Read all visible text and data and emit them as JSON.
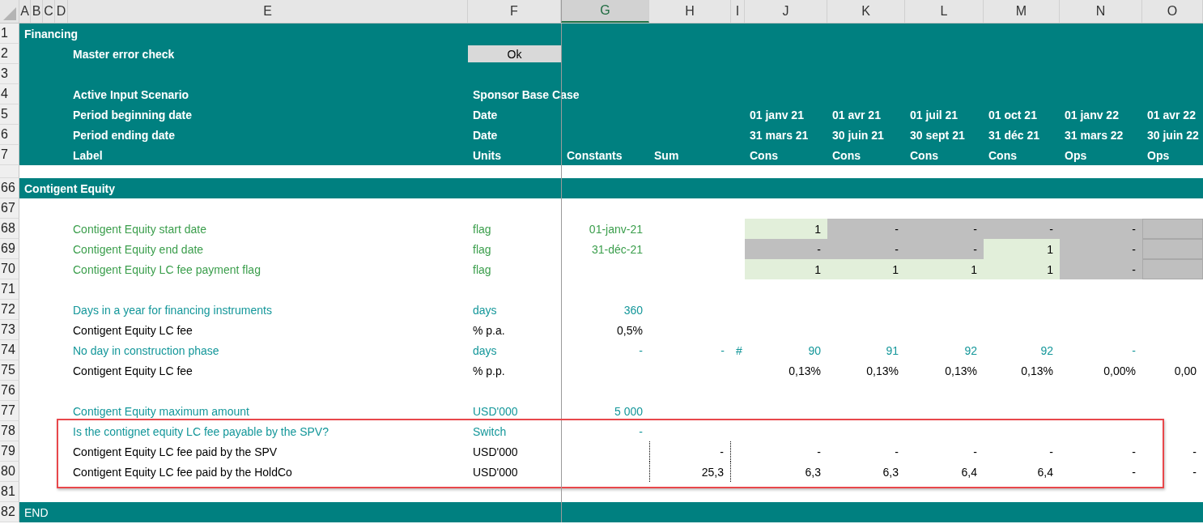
{
  "columns": [
    {
      "label": "A",
      "selected": false
    },
    {
      "label": "B",
      "selected": false
    },
    {
      "label": "C",
      "selected": false
    },
    {
      "label": "D",
      "selected": false
    },
    {
      "label": "E",
      "selected": false
    },
    {
      "label": "F",
      "selected": false
    },
    {
      "label": "G",
      "selected": true
    },
    {
      "label": "H",
      "selected": false
    },
    {
      "label": "I",
      "selected": false
    },
    {
      "label": "J",
      "selected": false
    },
    {
      "label": "K",
      "selected": false
    },
    {
      "label": "L",
      "selected": false
    },
    {
      "label": "M",
      "selected": false
    },
    {
      "label": "N",
      "selected": false
    },
    {
      "label": "O",
      "selected": false
    }
  ],
  "rows": [
    {
      "number": "1",
      "kind": "banner",
      "highlighted": false,
      "cells": [
        {
          "text": "Financing"
        },
        null,
        null,
        null,
        null,
        null,
        null,
        null,
        null,
        null,
        null,
        null,
        null,
        null,
        null
      ]
    },
    {
      "number": "2",
      "kind": "banner",
      "highlighted": false,
      "cells": [
        null,
        null,
        null,
        null,
        {
          "text": "Master error check"
        },
        {
          "text": "Ok",
          "kind": "status"
        },
        null,
        null,
        null,
        null,
        null,
        null,
        null,
        null,
        null
      ]
    },
    {
      "number": "3",
      "kind": "banner",
      "highlighted": false
    },
    {
      "number": "4",
      "kind": "banner",
      "highlighted": false,
      "cells": [
        null,
        null,
        null,
        null,
        {
          "text": "Active Input Scenario"
        },
        {
          "text": "Sponsor Base Case"
        },
        null,
        null,
        null,
        null,
        null,
        null,
        null,
        null,
        null
      ]
    },
    {
      "number": "5",
      "kind": "banner",
      "highlighted": false,
      "cells": [
        null,
        null,
        null,
        null,
        {
          "text": "Period beginning date"
        },
        {
          "text": "Date"
        },
        null,
        null,
        null,
        {
          "text": "01 janv 21"
        },
        {
          "text": "01 avr 21"
        },
        {
          "text": "01 juil 21"
        },
        {
          "text": "01 oct 21"
        },
        {
          "text": "01 janv 22"
        },
        {
          "text": "01 avr 22"
        }
      ]
    },
    {
      "number": "6",
      "kind": "banner",
      "highlighted": false,
      "cells": [
        null,
        null,
        null,
        null,
        {
          "text": "Period ending date"
        },
        {
          "text": "Date"
        },
        null,
        null,
        null,
        {
          "text": "31 mars 21"
        },
        {
          "text": "30 juin 21"
        },
        {
          "text": "30 sept 21"
        },
        {
          "text": "31 déc 21"
        },
        {
          "text": "31 mars 22"
        },
        {
          "text": "30 juin 22"
        }
      ]
    },
    {
      "number": "7",
      "kind": "banner",
      "highlighted": false,
      "cells": [
        null,
        null,
        null,
        null,
        {
          "text": "Label"
        },
        {
          "text": "Units"
        },
        {
          "text": "Constants"
        },
        {
          "text": "Sum"
        },
        null,
        {
          "text": "Cons"
        },
        {
          "text": "Cons"
        },
        {
          "text": "Cons"
        },
        {
          "text": "Cons"
        },
        {
          "text": "Ops"
        },
        {
          "text": "Ops"
        }
      ]
    },
    {
      "kind": "gap",
      "highlighted": false
    },
    {
      "number": "66",
      "kind": "banner",
      "highlighted": false,
      "cells": [
        {
          "text": "Contigent Equity"
        },
        null,
        null,
        null,
        null,
        null,
        null,
        null,
        null,
        null,
        null,
        null,
        null,
        null,
        null
      ]
    },
    {
      "number": "67",
      "kind": "body",
      "highlighted": false
    },
    {
      "number": "68",
      "kind": "body",
      "highlighted": false,
      "cells": [
        null,
        null,
        null,
        null,
        {
          "text": "Contigent Equity start date",
          "kind": "input"
        },
        {
          "text": "flag",
          "kind": "input"
        },
        {
          "text": "01-janv-21",
          "kind": "input",
          "numeric": true
        },
        null,
        null,
        {
          "text": "1",
          "kind": "calc",
          "numeric": true,
          "active": true
        },
        {
          "text": "-",
          "kind": "calc",
          "numeric": true,
          "active": false
        },
        {
          "text": "-",
          "kind": "calc",
          "numeric": true,
          "active": false
        },
        {
          "text": "-",
          "kind": "calc",
          "numeric": true,
          "active": false
        },
        {
          "text": "-",
          "kind": "calc",
          "numeric": true,
          "active": false
        },
        {
          "active": false
        }
      ]
    },
    {
      "number": "69",
      "kind": "body",
      "highlighted": false,
      "cells": [
        null,
        null,
        null,
        null,
        {
          "text": "Contigent Equity end date",
          "kind": "input"
        },
        {
          "text": "flag",
          "kind": "input"
        },
        {
          "text": "31-déc-21",
          "kind": "input",
          "numeric": true
        },
        null,
        null,
        {
          "text": "-",
          "kind": "calc",
          "numeric": true,
          "active": false
        },
        {
          "text": "-",
          "kind": "calc",
          "numeric": true,
          "active": false
        },
        {
          "text": "-",
          "kind": "calc",
          "numeric": true,
          "active": false
        },
        {
          "text": "1",
          "kind": "calc",
          "numeric": true,
          "active": true
        },
        {
          "text": "-",
          "kind": "calc",
          "numeric": true,
          "active": false
        },
        {
          "active": false
        }
      ]
    },
    {
      "number": "70",
      "kind": "body",
      "highlighted": false,
      "cells": [
        null,
        null,
        null,
        null,
        {
          "text": "Contigent Equity LC fee payment flag",
          "kind": "input"
        },
        {
          "text": "flag",
          "kind": "input"
        },
        null,
        null,
        null,
        {
          "text": "1",
          "kind": "calc",
          "numeric": true,
          "active": true
        },
        {
          "text": "1",
          "kind": "calc",
          "numeric": true,
          "active": true
        },
        {
          "text": "1",
          "kind": "calc",
          "numeric": true,
          "active": true
        },
        {
          "text": "1",
          "kind": "calc",
          "numeric": true,
          "active": true
        },
        {
          "text": "-",
          "kind": "calc",
          "numeric": true,
          "active": false
        },
        {
          "active": false
        }
      ]
    },
    {
      "number": "71",
      "kind": "body",
      "highlighted": false
    },
    {
      "number": "72",
      "kind": "body",
      "highlighted": false,
      "cells": [
        null,
        null,
        null,
        null,
        {
          "text": "Days in a year for financing instruments",
          "kind": "link"
        },
        {
          "text": "days",
          "kind": "link"
        },
        {
          "text": "360",
          "kind": "link",
          "numeric": true
        },
        null,
        null,
        null,
        null,
        null,
        null,
        null,
        null
      ]
    },
    {
      "number": "73",
      "kind": "body",
      "highlighted": false,
      "cells": [
        null,
        null,
        null,
        null,
        {
          "text": "Contigent Equity LC fee",
          "kind": "calc"
        },
        {
          "text": "% p.a.",
          "kind": "calc"
        },
        {
          "text": "0,5%",
          "kind": "calc",
          "numeric": true
        },
        null,
        null,
        null,
        null,
        null,
        null,
        null,
        null
      ]
    },
    {
      "number": "74",
      "kind": "body",
      "highlighted": false,
      "cells": [
        null,
        null,
        null,
        null,
        {
          "text": "No day in construction phase",
          "kind": "link"
        },
        {
          "text": "days",
          "kind": "link"
        },
        {
          "text": "-",
          "kind": "link",
          "numeric": true
        },
        {
          "text": "-",
          "kind": "link",
          "numeric": true
        },
        {
          "text": "#",
          "kind": "link"
        },
        {
          "text": "90",
          "kind": "link",
          "numeric": true
        },
        {
          "text": "91",
          "kind": "link",
          "numeric": true
        },
        {
          "text": "92",
          "kind": "link",
          "numeric": true
        },
        {
          "text": "92",
          "kind": "link",
          "numeric": true
        },
        {
          "text": "-",
          "kind": "link",
          "numeric": true
        },
        null
      ]
    },
    {
      "number": "75",
      "kind": "body",
      "highlighted": false,
      "cells": [
        null,
        null,
        null,
        null,
        {
          "text": "Contigent Equity LC fee",
          "kind": "calc"
        },
        {
          "text": "% p.p.",
          "kind": "calc"
        },
        null,
        null,
        null,
        {
          "text": "0,13%",
          "kind": "calc",
          "numeric": true
        },
        {
          "text": "0,13%",
          "kind": "calc",
          "numeric": true
        },
        {
          "text": "0,13%",
          "kind": "calc",
          "numeric": true
        },
        {
          "text": "0,13%",
          "kind": "calc",
          "numeric": true
        },
        {
          "text": "0,00%",
          "kind": "calc",
          "numeric": true
        },
        {
          "text": "0,00",
          "kind": "calc",
          "numeric": true
        }
      ]
    },
    {
      "number": "76",
      "kind": "body",
      "highlighted": false
    },
    {
      "number": "77",
      "kind": "body",
      "highlighted": false,
      "cells": [
        null,
        null,
        null,
        null,
        {
          "text": "Contigent Equity maximum amount",
          "kind": "link"
        },
        {
          "text": "USD'000",
          "kind": "link"
        },
        {
          "text": "5 000",
          "kind": "link",
          "numeric": true
        },
        null,
        null,
        null,
        null,
        null,
        null,
        null,
        null
      ]
    },
    {
      "number": "78",
      "kind": "body",
      "highlighted": true,
      "cells": [
        null,
        null,
        null,
        null,
        {
          "text": "Is the contignet equity LC fee payable by the SPV?",
          "kind": "link"
        },
        {
          "text": "Switch",
          "kind": "link"
        },
        {
          "text": "-",
          "kind": "link",
          "numeric": true
        },
        null,
        null,
        null,
        null,
        null,
        null,
        null,
        null
      ]
    },
    {
      "number": "79",
      "kind": "body",
      "highlighted": true,
      "cells": [
        null,
        null,
        null,
        null,
        {
          "text": "Contigent Equity LC fee paid by the SPV",
          "kind": "calc"
        },
        {
          "text": "USD'000",
          "kind": "calc"
        },
        null,
        {
          "text": "-",
          "kind": "calc",
          "numeric": true,
          "dotted": true
        },
        null,
        {
          "text": "-",
          "kind": "calc",
          "numeric": true
        },
        {
          "text": "-",
          "kind": "calc",
          "numeric": true
        },
        {
          "text": "-",
          "kind": "calc",
          "numeric": true
        },
        {
          "text": "-",
          "kind": "calc",
          "numeric": true
        },
        {
          "text": "-",
          "kind": "calc",
          "numeric": true
        },
        {
          "text": "-",
          "kind": "calc",
          "numeric": true
        }
      ]
    },
    {
      "number": "80",
      "kind": "body",
      "highlighted": true,
      "cells": [
        null,
        null,
        null,
        null,
        {
          "text": "Contigent Equity LC fee paid by the HoldCo",
          "kind": "calc"
        },
        {
          "text": "USD'000",
          "kind": "calc"
        },
        null,
        {
          "text": "25,3",
          "kind": "calc",
          "numeric": true,
          "dotted": true
        },
        null,
        {
          "text": "6,3",
          "kind": "calc",
          "numeric": true
        },
        {
          "text": "6,3",
          "kind": "calc",
          "numeric": true
        },
        {
          "text": "6,4",
          "kind": "calc",
          "numeric": true
        },
        {
          "text": "6,4",
          "kind": "calc",
          "numeric": true
        },
        {
          "text": "-",
          "kind": "calc",
          "numeric": true
        },
        {
          "text": "-",
          "kind": "calc",
          "numeric": true
        }
      ]
    },
    {
      "number": "81",
      "kind": "body",
      "highlighted": false
    },
    {
      "number": "82",
      "kind": "banner-plain",
      "highlighted": false,
      "cells": [
        {
          "text": "END"
        },
        null,
        null,
        null,
        null,
        null,
        null,
        null,
        null,
        null,
        null,
        null,
        null,
        null,
        null
      ]
    }
  ]
}
